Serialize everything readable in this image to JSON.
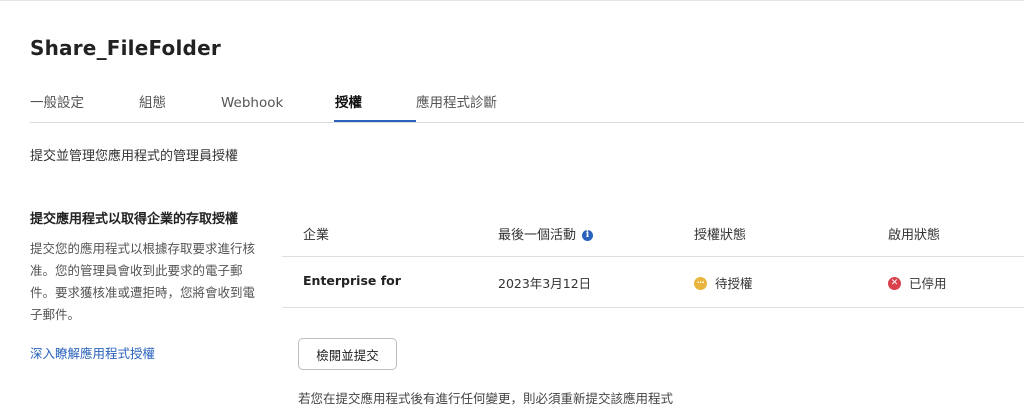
{
  "app": {
    "title": "Share_FileFolder"
  },
  "tabs": [
    {
      "label": "一般設定",
      "active": false
    },
    {
      "label": "組態",
      "active": false
    },
    {
      "label": "Webhook",
      "active": false
    },
    {
      "label": "授權",
      "active": true
    },
    {
      "label": "應用程式診斷",
      "active": false
    }
  ],
  "page": {
    "description": "提交並管理您應用程式的管理員授權"
  },
  "authorization_section": {
    "title": "提交應用程式以取得企業的存取授權",
    "body": "提交您的應用程式以根據存取要求進行核准。您的管理員會收到此要求的電子郵件。要求獲核准或遭拒時，您將會收到電子郵件。",
    "learn_more_link": "深入瞭解應用程式授權"
  },
  "table": {
    "headers": {
      "enterprise": "企業",
      "last_activity": "最後一個活動",
      "auth_status": "授權狀態",
      "enable_status": "啟用狀態"
    },
    "header_icons": {
      "last_activity": "info-icon"
    },
    "rows": [
      {
        "enterprise": "Enterprise for",
        "last_activity": "2023年3月12日",
        "auth_status": "待授權",
        "auth_status_icon": "pending-icon",
        "auth_status_color": "#e9b53c",
        "enable_status": "已停用",
        "enable_status_icon": "disabled-icon",
        "enable_status_color": "#d9404c"
      }
    ]
  },
  "actions": {
    "submit_label": "檢閱並提交"
  },
  "footnote": "若您在提交應用程式後有進行任何變更，則必須重新提交該應用程式",
  "colors": {
    "accent": "#2a62bc",
    "pending": "#e9b53c",
    "disabled": "#d9404c"
  }
}
